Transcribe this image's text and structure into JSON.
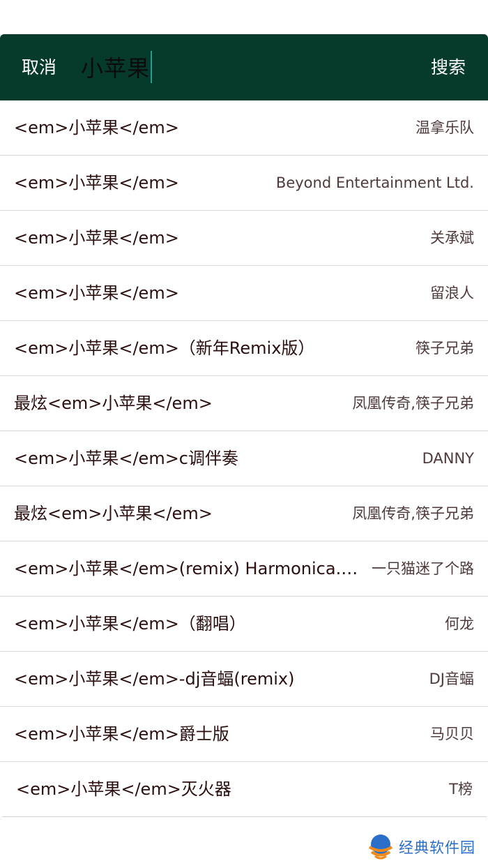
{
  "search_bar": {
    "cancel_label": "取消",
    "query": "小苹果",
    "submit_label": "搜索"
  },
  "results": [
    {
      "title": "<em>小苹果</em>",
      "artist": "温拿乐队"
    },
    {
      "title": "<em>小苹果</em>",
      "artist": "Beyond Entertainment Ltd."
    },
    {
      "title": "<em>小苹果</em>",
      "artist": "关承斌"
    },
    {
      "title": "<em>小苹果</em>",
      "artist": "留浪人"
    },
    {
      "title": "<em>小苹果</em>（新年Remix版）",
      "artist": "筷子兄弟"
    },
    {
      "title": "最炫<em>小苹果</em>",
      "artist": "凤凰传奇,筷子兄弟"
    },
    {
      "title": "<em>小苹果</em>c调伴奏",
      "artist": "DANNY"
    },
    {
      "title": "最炫<em>小苹果</em>",
      "artist": "凤凰传奇,筷子兄弟"
    },
    {
      "title": "<em>小苹果</em>(remix) Harmonica.V...",
      "artist": "一只猫迷了个路"
    },
    {
      "title": "<em>小苹果</em>（翻唱）",
      "artist": "何龙"
    },
    {
      "title": "<em>小苹果</em>-dj音蝠(remix)",
      "artist": "DJ音蝠"
    },
    {
      "title": "<em>小苹果</em>爵士版",
      "artist": "马贝贝"
    },
    {
      "title": "<em>小苹果</em>灭火器",
      "artist": "T榜"
    }
  ],
  "watermark": {
    "text": "经典软件园",
    "logo_icon": "globe-logo-icon"
  },
  "colors": {
    "header_bg": "#053a2c",
    "header_text": "#ffffff",
    "caret": "#2a9a8d",
    "title_text": "#2b0f0f",
    "artist_text": "#4e3a3a",
    "divider": "#d9d9d9",
    "watermark_blue": "#2a6ec9",
    "watermark_orange": "#f08a1c"
  }
}
